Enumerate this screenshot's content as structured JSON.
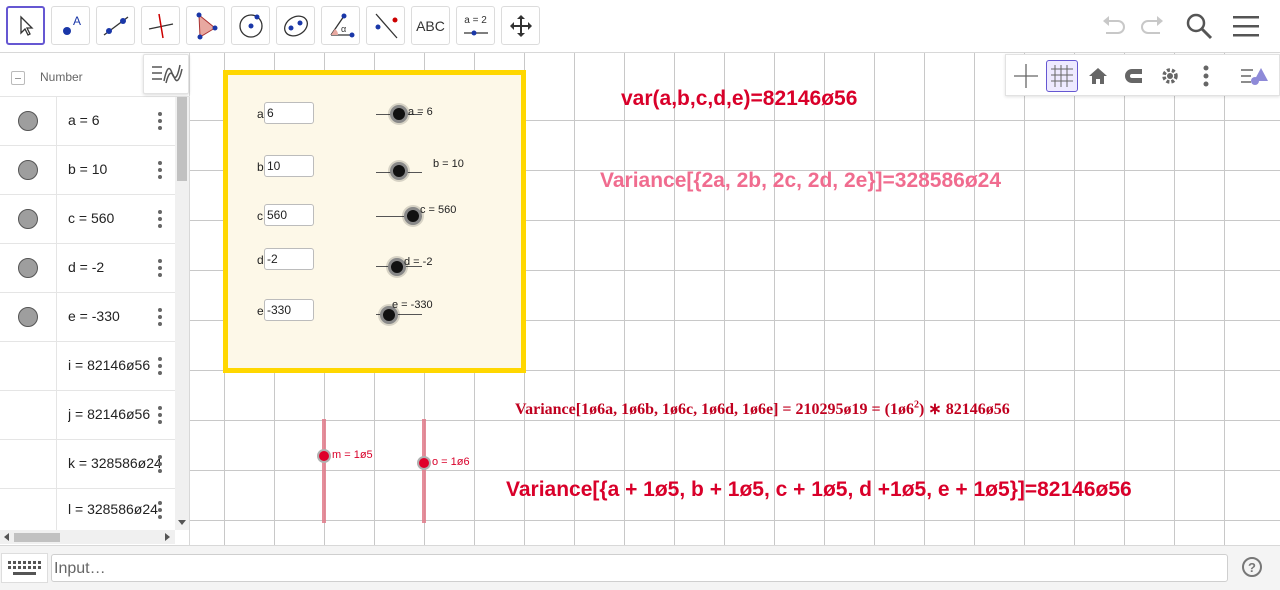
{
  "toolbar": {
    "tools": [
      {
        "name": "move-tool",
        "icon": "arrow-pointer-icon"
      },
      {
        "name": "point-tool",
        "icon": "point-icon",
        "label": "A"
      },
      {
        "name": "line-tool",
        "icon": "line-icon"
      },
      {
        "name": "perpendicular-tool",
        "icon": "perpendicular-line-icon"
      },
      {
        "name": "polygon-tool",
        "icon": "polygon-icon"
      },
      {
        "name": "circle-tool",
        "icon": "circle-center-point-icon"
      },
      {
        "name": "ellipse-tool",
        "icon": "ellipse-icon"
      },
      {
        "name": "angle-tool",
        "icon": "angle-icon",
        "label": "α"
      },
      {
        "name": "reflect-tool",
        "icon": "reflect-about-line-icon"
      },
      {
        "name": "text-tool",
        "icon": "text-icon",
        "label": "ABC"
      },
      {
        "name": "slider-tool",
        "icon": "slider-icon",
        "label": "a = 2"
      },
      {
        "name": "move-graphics-tool",
        "icon": "move-graphics-icon"
      }
    ],
    "right": [
      "undo-icon",
      "redo-icon",
      "search-icon",
      "menu-icon"
    ]
  },
  "algebra": {
    "sort_label": "Number",
    "rows": [
      {
        "text": "a = 6",
        "has_dot": true
      },
      {
        "text": "b = 10",
        "has_dot": true
      },
      {
        "text": "c = 560",
        "has_dot": true
      },
      {
        "text": "d = -2",
        "has_dot": true
      },
      {
        "text": "e = -330",
        "has_dot": true
      },
      {
        "text": "i = 82146ø56",
        "has_dot": false
      },
      {
        "text": "j = 82146ø56",
        "has_dot": false
      },
      {
        "text": "k = 328586ø24",
        "has_dot": false
      },
      {
        "text": "l = 328586ø24",
        "has_dot": false
      }
    ]
  },
  "graphics_style_bar": [
    "axes-icon",
    "grid-icon",
    "home-icon",
    "magnet-icon",
    "settings-gear-icon",
    "more-vert-icon",
    "style-bar-toggle-icon"
  ],
  "panel": {
    "inputs": [
      {
        "label": "a",
        "value": "6",
        "slider_label": "a = 6"
      },
      {
        "label": "b",
        "value": "10",
        "slider_label": "b = 10"
      },
      {
        "label": "c",
        "value": "560",
        "slider_label": "c = 560"
      },
      {
        "label": "d",
        "value": "-2",
        "slider_label": "d = -2"
      },
      {
        "label": "e",
        "value": "-330",
        "slider_label": "e = -330"
      }
    ]
  },
  "vertical_sliders": [
    {
      "label": "m = 1ø5"
    },
    {
      "label": "o = 1ø6"
    }
  ],
  "equations": {
    "var": "var(a,b,c,d,e)=82146ø56",
    "variance_2x": "Variance[{2a, 2b, 2c, 2d, 2e}]=328586ø24",
    "variance_scaled_lhs": "Variance[1ø6a, 1ø6b, 1ø6c, 1ø6d, 1ø6e] = 210295ø19 = (1ø6",
    "variance_scaled_exp": "2",
    "variance_scaled_rhs": ") ∗ 82146ø56",
    "variance_shift": "Variance[{a + 1ø5, b + 1ø5, c + 1ø5, d +1ø5, e + 1ø5}]=82146ø56"
  },
  "colors": {
    "crimson": "#d9002a",
    "pink": "#f06c8f",
    "dark_red": "#c0001f",
    "panel_border": "#ffd700",
    "panel_bg": "#fdf8e8"
  },
  "input_bar": {
    "placeholder": "Input…",
    "help": "?"
  }
}
